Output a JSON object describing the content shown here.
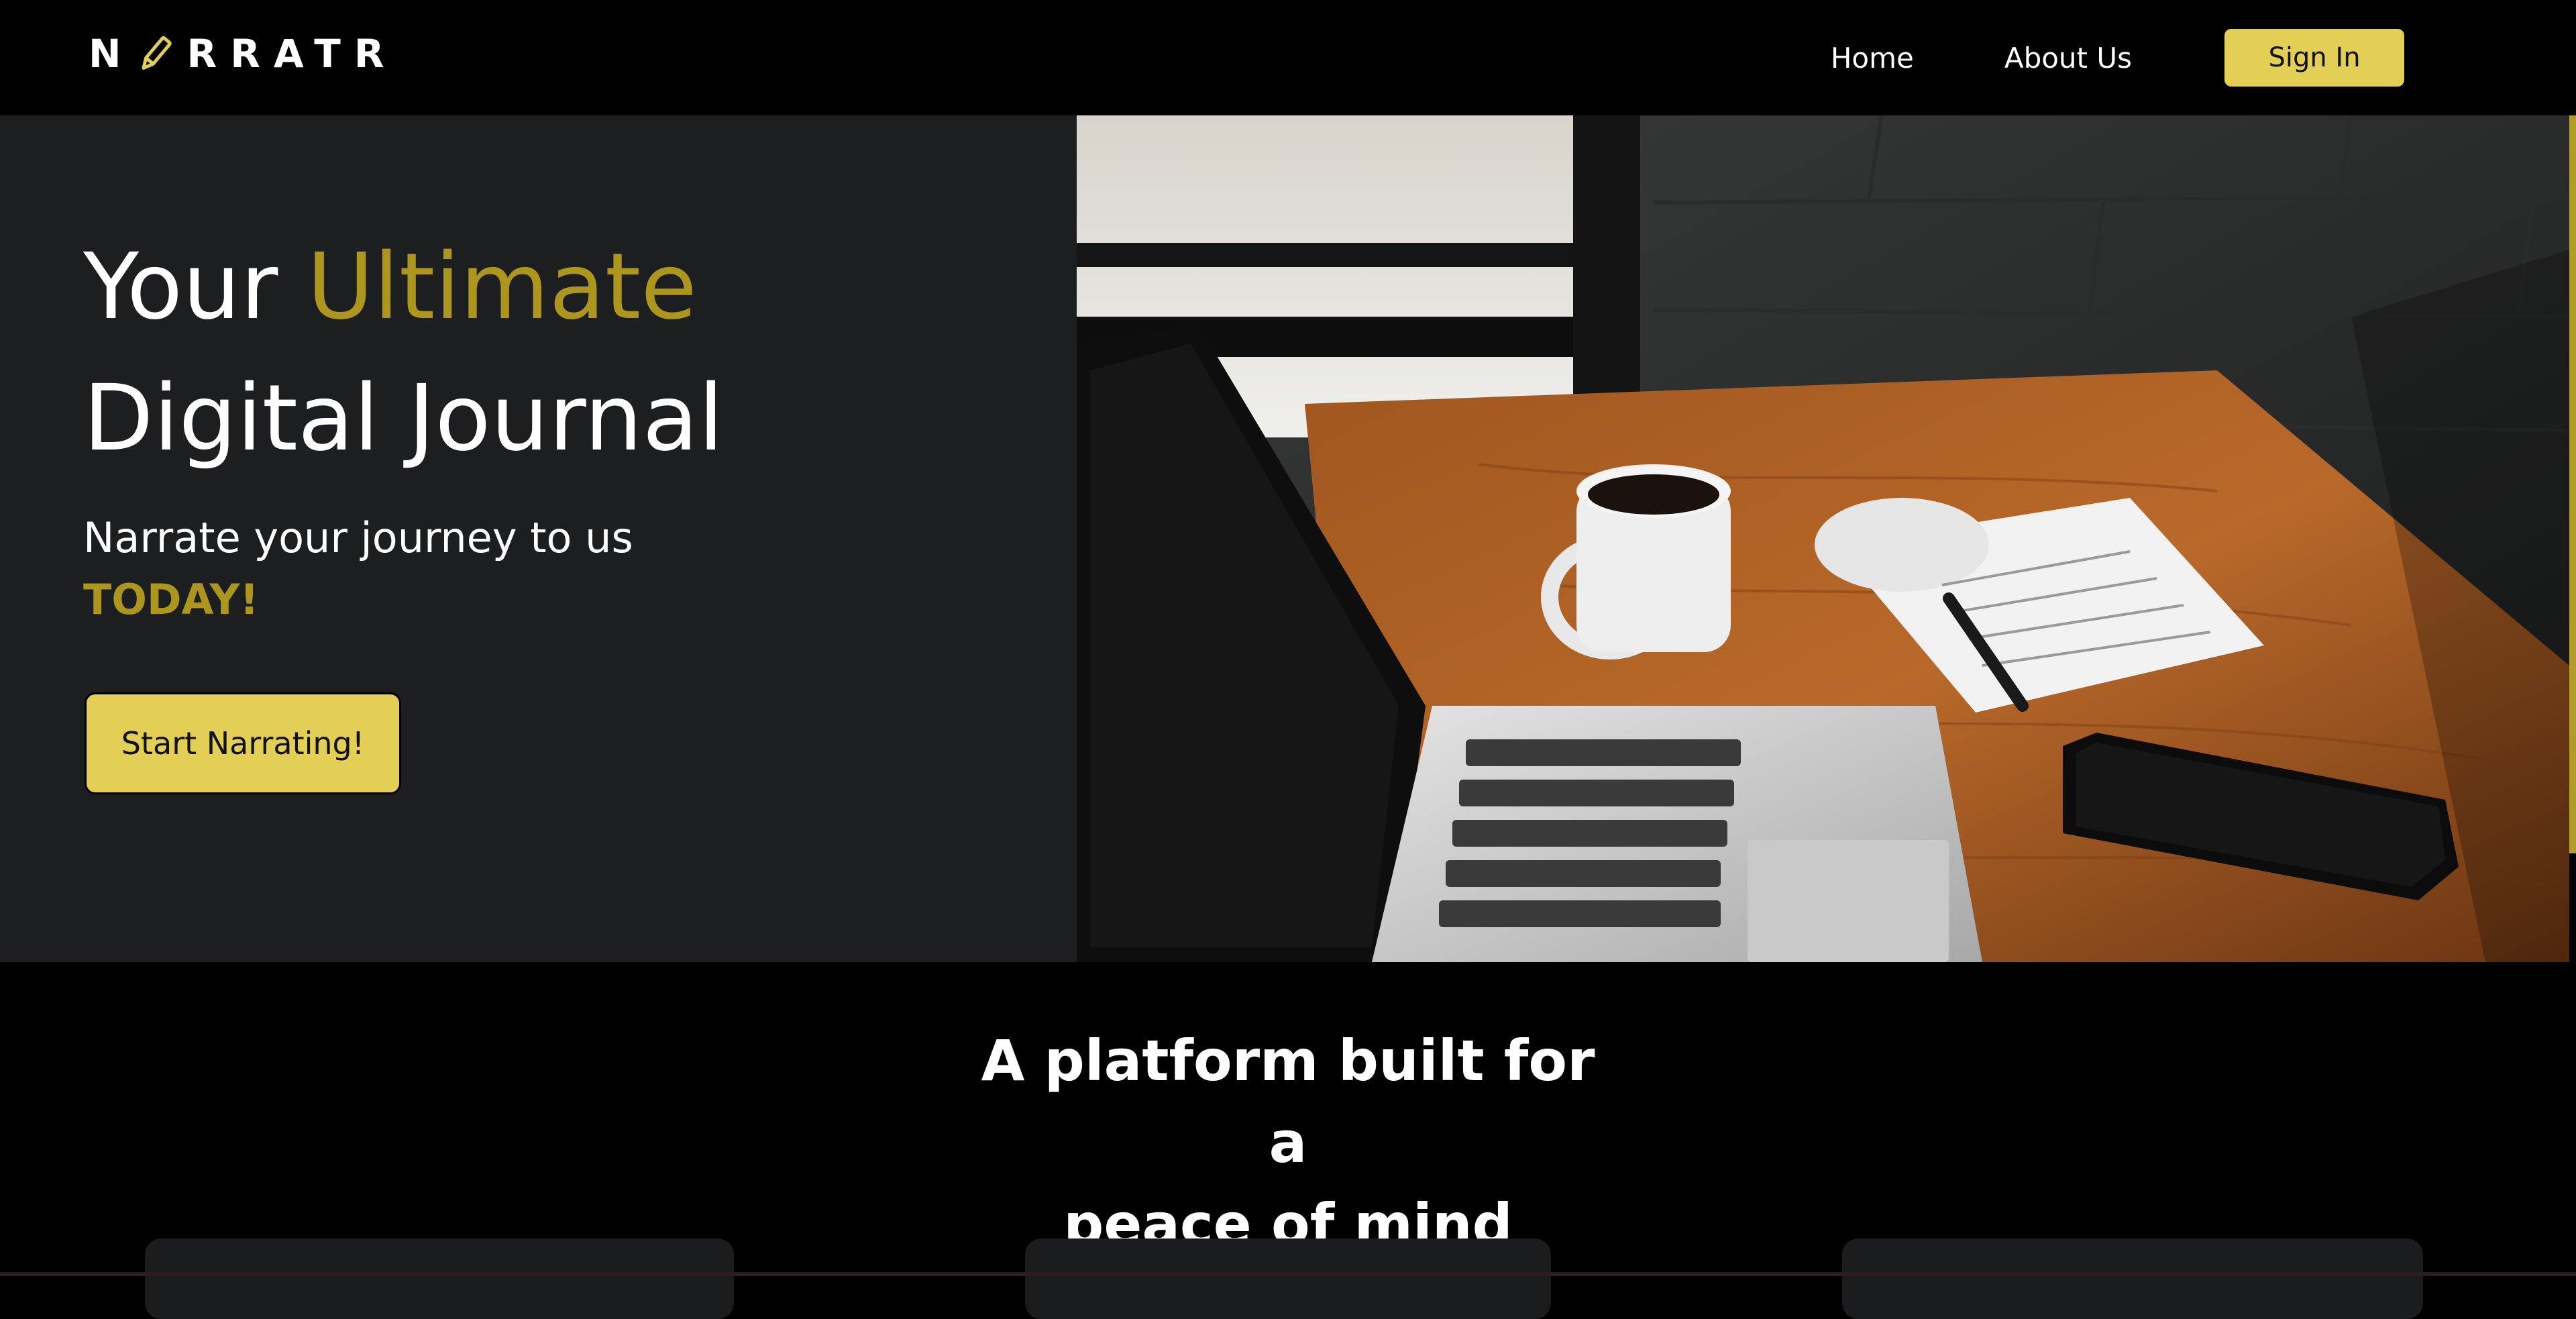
{
  "navbar": {
    "logo_left": "N",
    "logo_right": "RRATR",
    "links": [
      "Home",
      "About Us"
    ],
    "signin_label": "Sign In"
  },
  "hero": {
    "headline_word1": "Your",
    "headline_accent": "Ultimate",
    "headline_line2": "Digital Journal",
    "subline": "Narrate your journey to us",
    "subline_accent": "TODAY!",
    "cta_label": "Start Narrating!"
  },
  "section": {
    "title_line1": "A platform built for a",
    "title_line2": "peace of mind"
  },
  "colors": {
    "accent": "#ac961e",
    "button": "#e4cf56",
    "hero_bg": "#1d1e20",
    "page_bg": "#000000"
  },
  "icons": [
    "pencil-icon"
  ]
}
